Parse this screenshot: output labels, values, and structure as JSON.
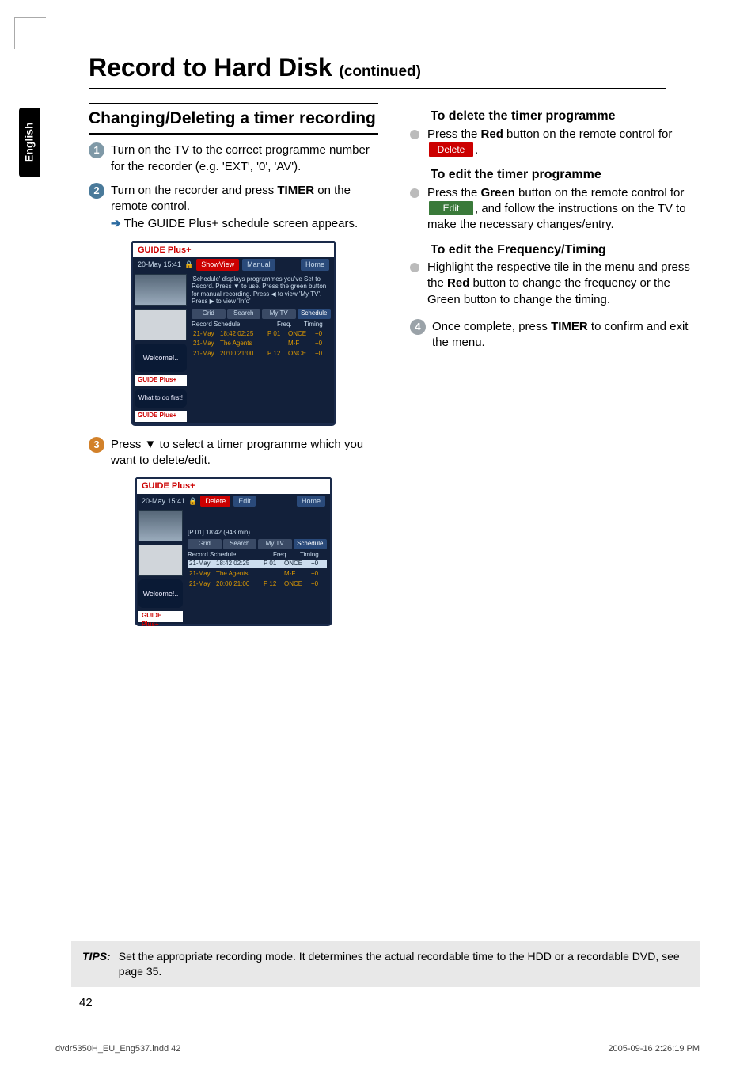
{
  "language_tab": "English",
  "page_title_main": "Record to Hard Disk",
  "page_title_cont": "(continued)",
  "section_heading": "Changing/Deleting a timer recording",
  "steps": {
    "s1": "Turn on the TV to the correct programme number for the recorder (e.g. 'EXT', '0', 'AV').",
    "s2a": "Turn on the recorder and press ",
    "s2b": "TIMER",
    "s2c": " on the remote control.",
    "s2d": "The GUIDE Plus+ schedule screen appears.",
    "s3a": "Press ▼ to select a timer programme which you want to delete/edit.",
    "s4a": "Once complete, press ",
    "s4b": "TIMER",
    "s4c": " to confirm and exit the menu."
  },
  "right": {
    "h_delete": "To delete the timer programme",
    "delete_a": "Press the ",
    "delete_b": "Red",
    "delete_c": " button on the remote control for ",
    "delete_pill": "Delete",
    "h_edit": "To edit the timer programme",
    "edit_a": "Press the ",
    "edit_b": "Green",
    "edit_c": " button on the remote control for ",
    "edit_pill": "Edit",
    "edit_d": ", and follow the instructions on the TV to make the necessary changes/entry.",
    "h_freq": "To edit the Frequency/Timing",
    "freq_a": "Highlight the respective tile in the menu and press the ",
    "freq_b": "Red",
    "freq_c": " button to change the frequency or the Green button to change the timing."
  },
  "shot1": {
    "logo": "GUIDE Plus+",
    "datetime": "20-May  15:41",
    "btn_showview": "ShowView",
    "btn_manual": "Manual",
    "btn_home": "Home",
    "desc": "'Schedule' displays programmes you've Set to Record. Press ▼ to use. Press the green button for manual recording. Press ◀ to view 'My TV'. Press ▶ to view 'Info'",
    "tabs": [
      "Grid",
      "Search",
      "My TV",
      "Schedule"
    ],
    "header": [
      "Record Schedule",
      "Freq.",
      "Timing"
    ],
    "rows": [
      {
        "date": "21-May",
        "time": "18:42  02:25",
        "ch": "P 01",
        "freq": "ONCE",
        "timing": "+0"
      },
      {
        "date": "21-May",
        "title": "The Agents",
        "ch": "",
        "freq": "M-F",
        "timing": "+0"
      },
      {
        "date": "21-May",
        "time": "20:00  21:00",
        "ch": "P 12",
        "freq": "ONCE",
        "timing": "+0"
      }
    ],
    "welcome": "Welcome!..",
    "first": "What to do first!"
  },
  "shot2": {
    "logo": "GUIDE Plus+",
    "datetime": "20-May  15:41",
    "btn_delete": "Delete",
    "btn_edit": "Edit",
    "btn_home": "Home",
    "sub": "[P 01]     18:42 (943 min)",
    "tabs": [
      "Grid",
      "Search",
      "My TV",
      "Schedule"
    ],
    "header": [
      "Record Schedule",
      "Freq.",
      "Timing"
    ],
    "rows": [
      {
        "date": "21-May",
        "time": "18:42  02:25",
        "ch": "P 01",
        "freq": "ONCE",
        "timing": "+0",
        "hi": true
      },
      {
        "date": "21-May",
        "title": "The Agents",
        "ch": "",
        "freq": "M-F",
        "timing": "+0"
      },
      {
        "date": "21-May",
        "time": "20:00  21:00",
        "ch": "P 12",
        "freq": "ONCE",
        "timing": "+0"
      }
    ],
    "welcome": "Welcome!.."
  },
  "tips_label": "TIPS:",
  "tips_text": "Set the appropriate recording mode. It determines the actual recordable time to the HDD or a recordable DVD, see page 35.",
  "page_number": "42",
  "footer_left": "dvdr5350H_EU_Eng537.indd   42",
  "footer_right": "2005-09-16   2:26:19 PM"
}
